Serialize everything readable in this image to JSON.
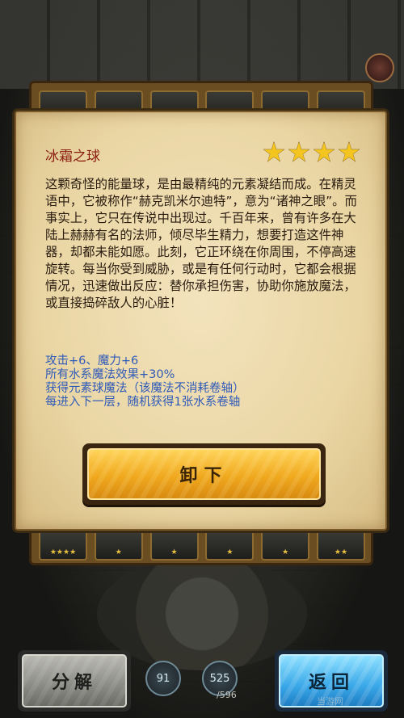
{
  "item": {
    "name": "冰霜之球",
    "stars": 4,
    "description": "这颗奇怪的能量球，是由最精纯的元素凝结而成。在精灵语中，它被称作“赫克凯米尔迪特”，意为“诸神之眼”。而事实上，它只在传说中出现过。千百年来，曾有许多在大陆上赫赫有名的法师，倾尽毕生精力，想要打造这件神器，却都未能如愿。此刻，它正环绕在你周围，不停高速旋转。每当你受到威胁，或是有任何行动时，它都会根据情况，迅速做出反应：替你承担伤害，协助你施放魔法，或直接捣碎敌人的心脏！",
    "stats": [
      "攻击+6、魔力+6",
      "所有水系魔法效果+30%",
      "获得元素球魔法（该魔法不消耗卷轴）",
      "每进入下一层，随机获得1张水系卷轴"
    ]
  },
  "buttons": {
    "unequip": "卸下",
    "decompose": "分解",
    "back": "返回"
  },
  "counters": {
    "a": "91",
    "b": "525",
    "b_total": "/596"
  },
  "watermark": "当游网",
  "colors": {
    "title": "#8a1c10",
    "stats": "#2f5ab8",
    "star": "#f3c51e"
  }
}
